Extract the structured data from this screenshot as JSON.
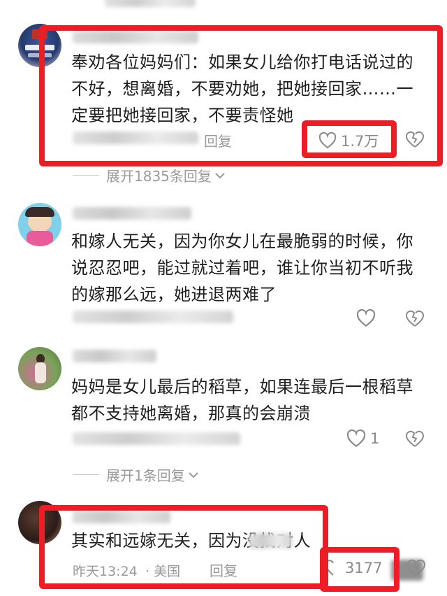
{
  "comments": [
    {
      "text": "奉劝各位妈妈们：如果女儿给你打电话说过的不好，想离婚，不要劝她，把她接回家……一定要把她接回家，不要责怪她",
      "reply": "回复",
      "likes": "1.7万",
      "expand": "展开1835条回复"
    },
    {
      "text": "和嫁人无关，因为你女儿在最脆弱的时候，你说忍忍吧，能过就过着吧，谁让你当初不听我的嫁那么远，她进退两难了"
    },
    {
      "text": "妈妈是女儿最后的稻草，如果连最后一根稻草都不支持她离婚，那真的会崩溃",
      "likes": "1",
      "expand": "展开1条回复"
    },
    {
      "text": "其实和远嫁无关，因为没找对人",
      "time": "昨天13:24",
      "location": "美国",
      "reply": "回复",
      "likes": "3177"
    }
  ],
  "colors": {
    "highlight": "#ee1c24",
    "muted": "#9a9a9a"
  },
  "icons": [
    "heart-icon",
    "broken-heart-icon",
    "chevron-down-icon"
  ]
}
